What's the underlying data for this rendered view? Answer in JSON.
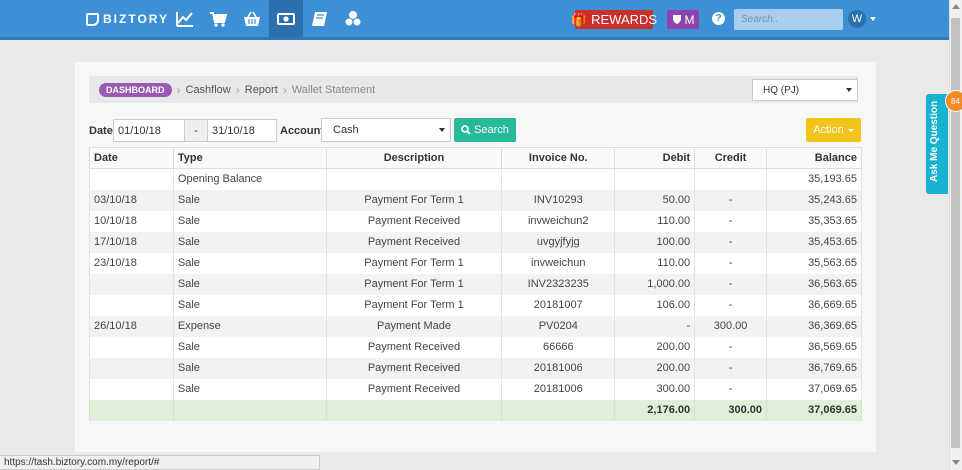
{
  "navbar": {
    "brand": "BIZTORY",
    "icons": [
      "chart-line-icon",
      "cart-icon",
      "basket-icon",
      "money-icon",
      "book-icon",
      "coins-icon"
    ],
    "rewards_label": "REWARDS",
    "member_label": "M",
    "search_placeholder": "Search..",
    "user_initial": "W"
  },
  "ask_tab": {
    "label": "Ask Me Question",
    "bubble": "84"
  },
  "breadcrumb": {
    "dashboard": "DASHBOARD",
    "items": [
      "Cashflow",
      "Report",
      "Wallet Statement"
    ]
  },
  "branch_select": {
    "value": "HQ (PJ)"
  },
  "filters": {
    "date_label": "Date",
    "date_from": "01/10/18",
    "date_sep": "-",
    "date_to": "31/10/18",
    "account_label": "Account",
    "account_value": "Cash",
    "search_label": "Search",
    "action_label": "Action"
  },
  "table": {
    "headers": [
      "Date",
      "Type",
      "Description",
      "Invoice No.",
      "Debit",
      "Credit",
      "Balance"
    ],
    "rows": [
      [
        "",
        "Opening Balance",
        "",
        "",
        "",
        "",
        "35,193.65"
      ],
      [
        "03/10/18",
        "Sale",
        "Payment For Term 1",
        "INV10293",
        "50.00",
        "-",
        "35,243.65"
      ],
      [
        "10/10/18",
        "Sale",
        "Payment Received",
        "invweichun2",
        "110.00",
        "-",
        "35,353.65"
      ],
      [
        "17/10/18",
        "Sale",
        "Payment Received",
        "uvgyjfyjg",
        "100.00",
        "-",
        "35,453.65"
      ],
      [
        "23/10/18",
        "Sale",
        "Payment For Term 1",
        "invweichun",
        "110.00",
        "-",
        "35,563.65"
      ],
      [
        "",
        "Sale",
        "Payment For Term 1",
        "INV2323235",
        "1,000.00",
        "-",
        "36,563.65"
      ],
      [
        "",
        "Sale",
        "Payment For Term 1",
        "20181007",
        "106.00",
        "-",
        "36,669.65"
      ],
      [
        "26/10/18",
        "Expense",
        "Payment Made",
        "PV0204",
        "-",
        "300.00",
        "36,369.65"
      ],
      [
        "",
        "Sale",
        "Payment Received",
        "66666",
        "200.00",
        "-",
        "36,569.65"
      ],
      [
        "",
        "Sale",
        "Payment Received",
        "20181006",
        "200.00",
        "-",
        "36,769.65"
      ],
      [
        "",
        "Sale",
        "Payment Received",
        "20181006",
        "300.00",
        "-",
        "37,069.65"
      ]
    ],
    "totals": {
      "debit": "2,176.00",
      "credit": "300.00",
      "balance": "37,069.65"
    }
  },
  "status_url": "https://tash.biztory.com.my/report/#",
  "colors": {
    "navbar": "#3d8fd6",
    "rewards": "#c9302c",
    "member": "#8e44ad",
    "dashboard_badge": "#9b59b6",
    "search_button": "#26b99a",
    "action_button": "#f0c419",
    "totals_row": "#dff0d8",
    "ask_tab": "#17b3d1"
  }
}
